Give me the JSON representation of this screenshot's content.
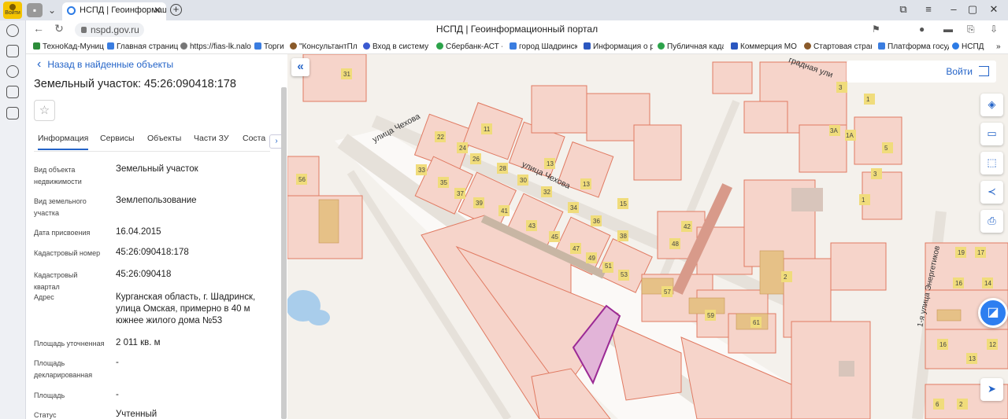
{
  "browser": {
    "profile_label": "Войти",
    "tab_title": "НСПД | Геоинформац",
    "tab_close": "✕",
    "new_tab": "+",
    "url": "nspd.gov.ru",
    "page_title": "НСПД | Геоинформационный портал",
    "bookmarks": [
      {
        "label": "ТехноКад-Муниц",
        "color": "#2c8c3a"
      },
      {
        "label": "Главная страниц",
        "color": "#3a7de0"
      },
      {
        "label": "https://fias-lk.nalo",
        "color": "#777777"
      },
      {
        "label": "Торги",
        "color": "#3a7de0"
      },
      {
        "label": "\"КонсультантПлю",
        "color": "#8a5a2a"
      },
      {
        "label": "Вход в систему :",
        "color": "#3a5ad0"
      },
      {
        "label": "Сбербанк-АСТ - :",
        "color": "#2ca34a"
      },
      {
        "label": "город Шадринск",
        "color": "#3a7de0"
      },
      {
        "label": "Информация о р",
        "color": "#2b57c0"
      },
      {
        "label": "Публичная кадас",
        "color": "#2ca34a"
      },
      {
        "label": "Коммерция МО.:",
        "color": "#2b57c0"
      },
      {
        "label": "Стартовая стран",
        "color": "#8a5a2a"
      },
      {
        "label": "Платформа госуд",
        "color": "#3a7de0"
      },
      {
        "label": "НСПД",
        "color": "#2c7be5"
      }
    ]
  },
  "panel": {
    "back_link": "Назад в найденные объекты",
    "title": "Земельный участок: 45:26:090418:178",
    "tabs": [
      "Информация",
      "Сервисы",
      "Объекты",
      "Части ЗУ",
      "Соста"
    ],
    "fields": [
      {
        "key": "Вид объекта недвижимости",
        "value": "Земельный участок"
      },
      {
        "key": "Вид земельного участка",
        "value": "Землепользование"
      },
      {
        "key": "Дата присвоения",
        "value": "16.04.2015"
      },
      {
        "key": "Кадастровый номер",
        "value": "45:26:090418:178"
      },
      {
        "key": "Кадастровый квартал",
        "value": "45:26:090418"
      },
      {
        "key": "Адрес",
        "value": "Курганская область, г. Шадринск, улица Омская, примерно в 40 м южнее жилого дома №53"
      },
      {
        "key": "Площадь уточненная",
        "value": "2 011 кв. м"
      },
      {
        "key": "Площадь декларированная",
        "value": "-"
      },
      {
        "key": "Площадь",
        "value": "-"
      },
      {
        "key": "Статус",
        "value": "Учтенный"
      }
    ]
  },
  "map": {
    "login_label": "Войти",
    "street_labels": [
      "улица Чехова",
      "улица Чехова",
      "градная ули",
      "1-я улица Энергетиков"
    ],
    "house_numbers": [
      "31",
      "11",
      "22",
      "24",
      "26",
      "28",
      "30",
      "32",
      "33",
      "35",
      "37",
      "39",
      "41",
      "43",
      "45",
      "47",
      "49",
      "51",
      "53",
      "34",
      "36",
      "38",
      "13",
      "13",
      "15",
      "56",
      "42",
      "48",
      "57",
      "59",
      "61",
      "2",
      "3",
      "1",
      "3A",
      "1A",
      "5",
      "3",
      "1",
      "19",
      "17",
      "16",
      "14",
      "16",
      "12",
      "13",
      "6",
      "2"
    ]
  }
}
